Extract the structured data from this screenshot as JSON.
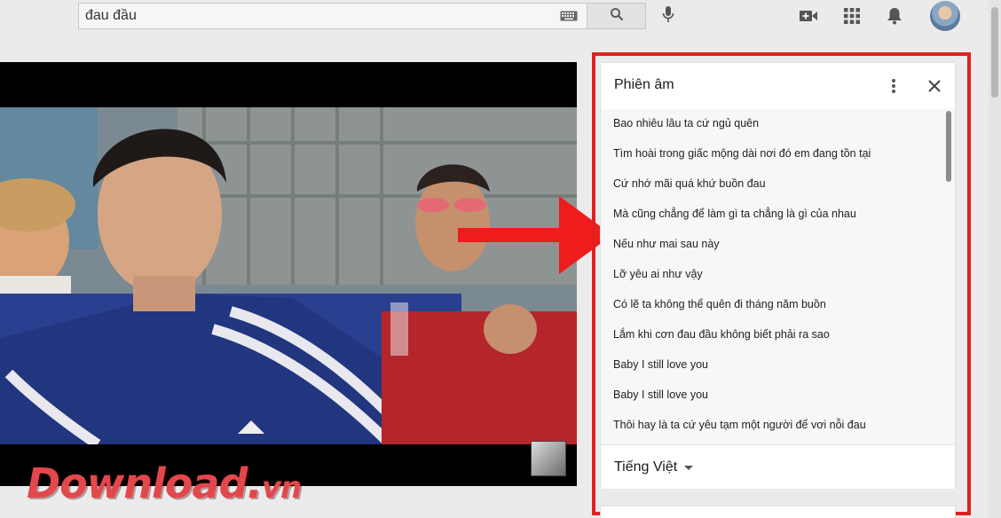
{
  "search": {
    "value": "đau đầu",
    "keyboard_icon": "keyboard-icon",
    "search_icon": "search-icon",
    "mic_icon": "microphone-icon"
  },
  "header_icons": [
    "create-video-icon",
    "apps-grid-icon",
    "notifications-bell-icon",
    "avatar"
  ],
  "transcript_panel": {
    "title": "Phiên âm",
    "more_icon": "more-vert-icon",
    "close_icon": "close-icon",
    "lines": [
      "Bao nhiêu lâu ta cứ ngủ quên",
      "Tìm hoài trong giấc mộng dài nơi đó em đang tồn tại",
      "Cứ nhớ mãi quá khứ buồn đau",
      "Mà cũng chẳng để làm gì ta chẳng là gì của nhau",
      "Nếu như mai sau này",
      "Lỡ yêu ai như vậy",
      "Có lẽ ta không thể quên đi tháng năm buồn",
      "Lắm khi cơn đau đầu không biết phải ra sao",
      "Baby I still love you",
      "Baby I still love you",
      "Thôi hay là ta cứ yêu tạm một người để vơi nỗi đau"
    ],
    "language": "Tiếng Việt"
  },
  "watermark": {
    "main": "Download",
    "dot": ".",
    "tld": "vn"
  },
  "colors": {
    "highlight": "#e1201f",
    "arrow": "#ee1c1c",
    "page_background": "#ebebeb"
  }
}
